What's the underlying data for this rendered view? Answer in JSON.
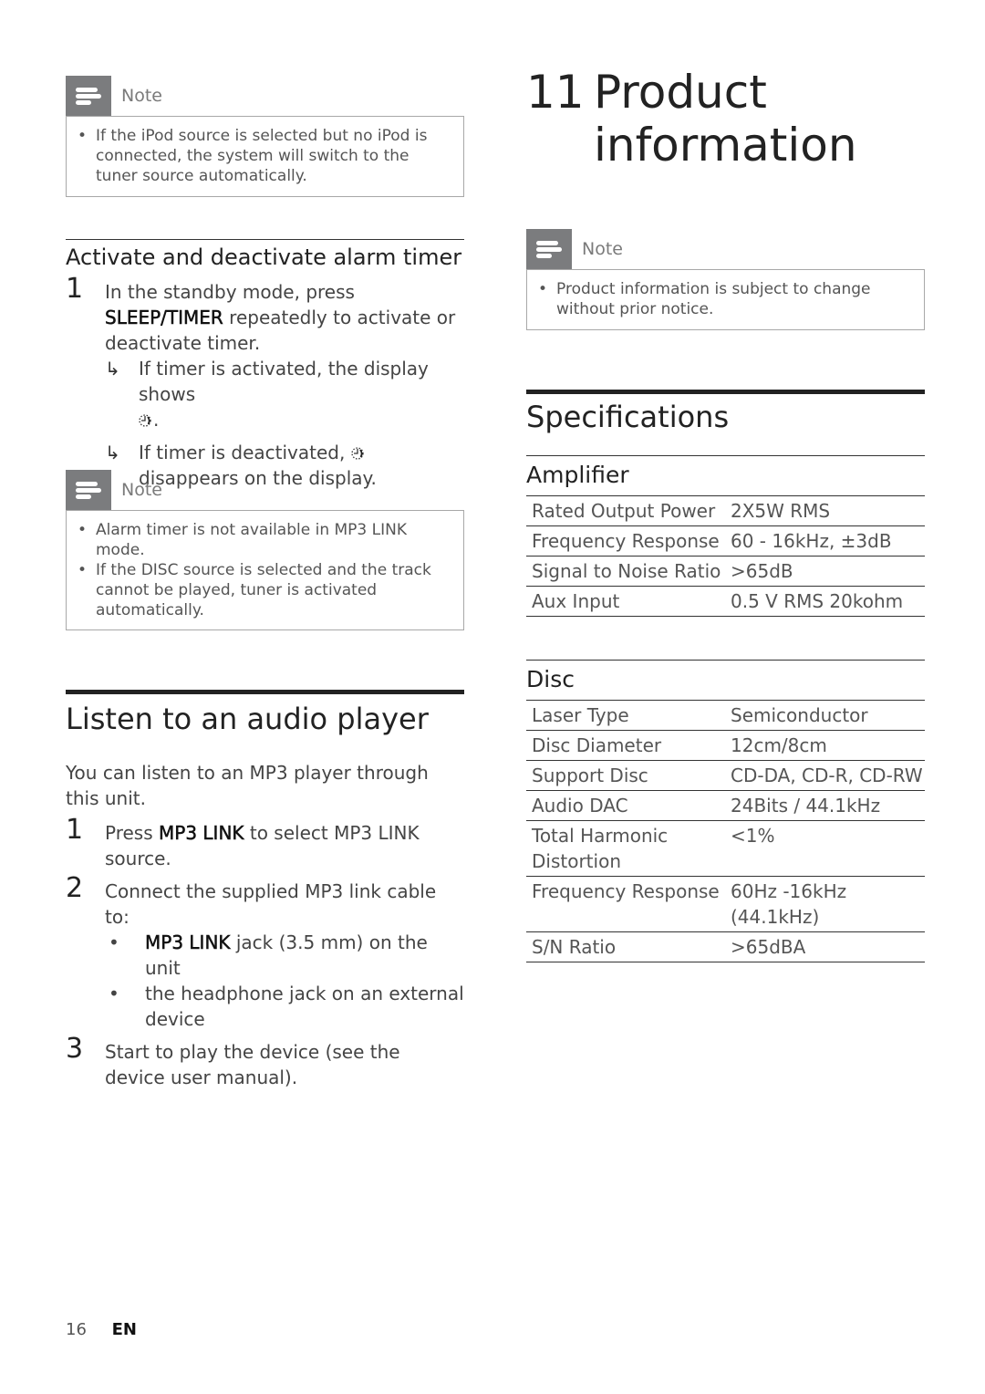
{
  "left": {
    "note1": {
      "label": "Note",
      "items": [
        "If the iPod source is selected but no iPod is connected, the system will switch to the tuner source automatically."
      ]
    },
    "alarm_section": {
      "title": "Activate and deactivate alarm timer",
      "step1": {
        "num": "1",
        "text_before": "In the standby mode, press ",
        "key": "SLEEP/TIMER",
        "text_after": " repeatedly to activate or deactivate timer.",
        "result1_before": "If timer is activated, the display shows",
        "result1_after": ".",
        "result2_before": "If timer is deactivated,",
        "result2_after": "disappears on the display.",
        "arrow": "↳",
        "timer_icon": "timer-icon"
      }
    },
    "note2": {
      "label": "Note",
      "items": [
        "Alarm timer is not available in MP3 LINK mode.",
        "If the DISC source is selected and the track cannot be played, tuner is activated automatically."
      ]
    },
    "audio_section": {
      "title": "Listen to an audio player",
      "intro": "You can listen to an MP3 player through this unit.",
      "step1": {
        "num": "1",
        "before": "Press ",
        "key": "MP3 LINK",
        "after": " to select MP3 LINK source."
      },
      "step2": {
        "num": "2",
        "text": "Connect the supplied MP3 link cable to:",
        "bullet1_key": "MP3 LINK",
        "bullet1_after": " jack (3.5 mm) on the unit",
        "bullet2": "the headphone jack on an external device",
        "bullet_glyph": "•"
      },
      "step3": {
        "num": "3",
        "text": "Start to play the device (see the device user manual)."
      }
    }
  },
  "right": {
    "chapter": {
      "number": "11",
      "title": "Product information"
    },
    "note": {
      "label": "Note",
      "items": [
        "Product information is subject to change without prior notice."
      ]
    },
    "specifications_title": "Specifications",
    "amplifier": {
      "title": "Amplifier",
      "rows": [
        {
          "label": "Rated Output Power",
          "value": "2X5W RMS"
        },
        {
          "label": "Frequency Response",
          "value": "60 - 16kHz, ±3dB"
        },
        {
          "label": "Signal to Noise Ratio",
          "value": ">65dB"
        },
        {
          "label": "Aux Input",
          "value": "0.5 V RMS 20kohm"
        }
      ]
    },
    "disc": {
      "title": "Disc",
      "rows": [
        {
          "label": "Laser Type",
          "value": "Semiconductor"
        },
        {
          "label": "Disc Diameter",
          "value": "12cm/8cm"
        },
        {
          "label": "Support Disc",
          "value": "CD-DA, CD-R, CD-RW"
        },
        {
          "label": "Audio DAC",
          "value": "24Bits / 44.1kHz"
        },
        {
          "label": "Total Harmonic Distortion",
          "value": "<1%"
        },
        {
          "label": "Frequency Response",
          "value": "60Hz -16kHz (44.1kHz)"
        },
        {
          "label": "S/N Ratio",
          "value": ">65dBA"
        }
      ]
    }
  },
  "footer": {
    "page_number": "16",
    "language": "EN"
  }
}
